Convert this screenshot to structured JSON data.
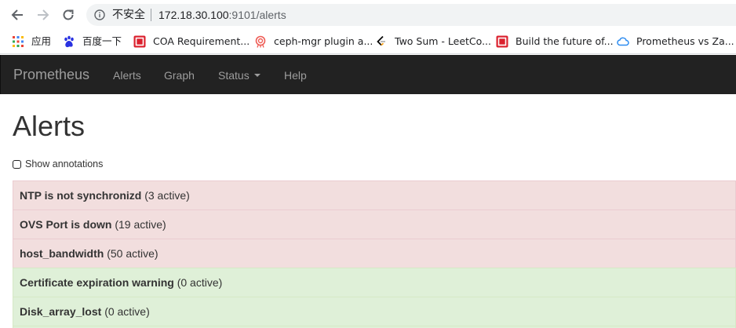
{
  "browser": {
    "security_label": "不安全",
    "url_host": "172.18.30.100",
    "url_rest": ":9101/alerts",
    "bookmarks": [
      {
        "icon": "apps-grid-icon",
        "label": "应用"
      },
      {
        "icon": "baidu-paw-icon",
        "label": "百度一下"
      },
      {
        "icon": "openshift-icon",
        "label": "COA Requirement..."
      },
      {
        "icon": "ceph-icon",
        "label": "ceph-mgr plugin a..."
      },
      {
        "icon": "leetcode-icon",
        "label": "Two Sum - LeetCo..."
      },
      {
        "icon": "openshift-icon",
        "label": "Build the future of..."
      },
      {
        "icon": "cloud-icon",
        "label": "Prometheus vs Za..."
      }
    ]
  },
  "navbar": {
    "brand": "Prometheus",
    "links": [
      "Alerts",
      "Graph",
      "Status",
      "Help"
    ]
  },
  "page": {
    "title": "Alerts",
    "show_annotations_label": "Show annotations"
  },
  "alerts": [
    {
      "name": "NTP is not synchronizd",
      "count": "(3 active)",
      "state": "firing"
    },
    {
      "name": "OVS Port is down",
      "count": "(19 active)",
      "state": "firing"
    },
    {
      "name": "host_bandwidth",
      "count": "(50 active)",
      "state": "firing"
    },
    {
      "name": "Certificate expiration warning",
      "count": "(0 active)",
      "state": "inactive"
    },
    {
      "name": "Disk_array_lost",
      "count": "(0 active)",
      "state": "inactive"
    }
  ],
  "colors": {
    "navbar_bg": "#222222",
    "firing_bg": "#f2dede",
    "inactive_bg": "#dff0d8"
  }
}
